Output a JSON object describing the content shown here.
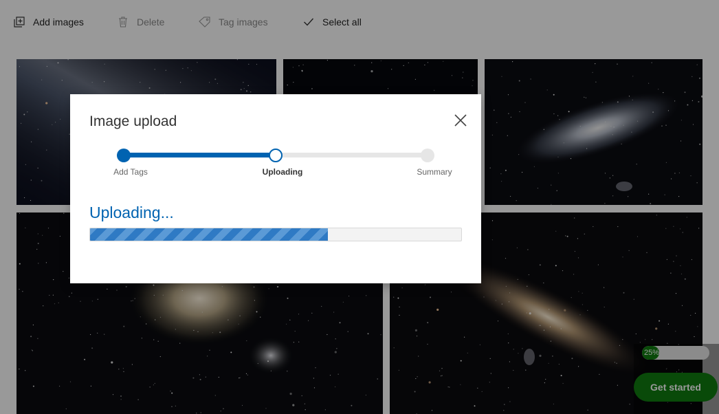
{
  "toolbar": {
    "add_images": "Add images",
    "delete": "Delete",
    "tag_images": "Tag images",
    "select_all": "Select all"
  },
  "dialog": {
    "title": "Image upload",
    "steps": [
      {
        "label": "Add Tags",
        "state": "done"
      },
      {
        "label": "Uploading",
        "state": "current"
      },
      {
        "label": "Summary",
        "state": "pending"
      }
    ],
    "status_text": "Uploading...",
    "upload_progress": 0.64
  },
  "tour": {
    "progress_text": "25%",
    "progress": 0.25,
    "get_started_label": "Get started"
  },
  "colors": {
    "accent": "#0063b1",
    "green": "#107c10"
  },
  "icons": [
    "add-images-icon",
    "delete-icon",
    "tag-icon",
    "checkmark-icon",
    "close-icon"
  ]
}
